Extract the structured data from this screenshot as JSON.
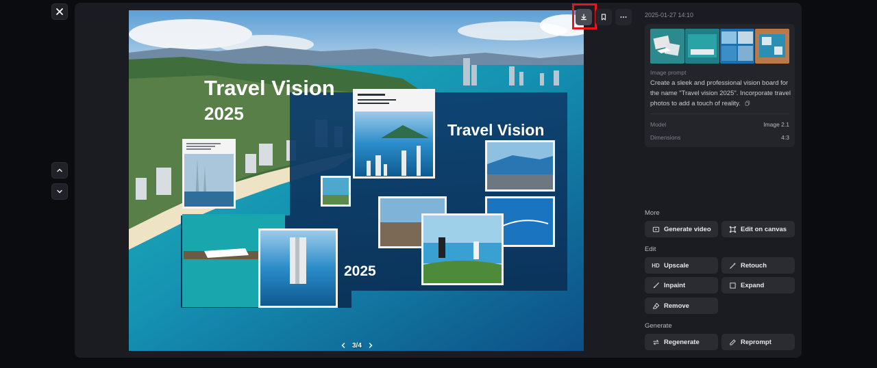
{
  "viewer": {
    "pager": {
      "current": "3/4"
    },
    "image": {
      "headline_1": "Travel Vision",
      "headline_2": "2025",
      "headline_3": "Travel Vision",
      "headline_4": "2025"
    }
  },
  "toolbar": {
    "download_icon": "download-icon",
    "bookmark_icon": "bookmark-icon",
    "more_icon": "more-icon"
  },
  "sidebar": {
    "timestamp": "2025-01-27 14:10",
    "prompt_label": "Image prompt",
    "prompt_text": "Create a sleek and professional vision board for the name \"Travel vision 2025\". Incorporate travel photos to add a touch of reality.",
    "model_label": "Model",
    "model_value": "Image 2.1",
    "dimensions_label": "Dimensions",
    "dimensions_value": "4:3",
    "sections": {
      "more": "More",
      "edit": "Edit",
      "generate": "Generate"
    },
    "actions": {
      "generate_video": "Generate video",
      "edit_on_canvas": "Edit on canvas",
      "upscale": "Upscale",
      "upscale_badge": "HD",
      "retouch": "Retouch",
      "inpaint": "Inpaint",
      "expand": "Expand",
      "remove": "Remove",
      "regenerate": "Regenerate",
      "reprompt": "Reprompt"
    }
  },
  "colors": {
    "background": "#0b0c0f",
    "panel": "#1a1c21",
    "card": "#23252b",
    "button": "#2a2c32",
    "highlight": "#e8161c"
  }
}
